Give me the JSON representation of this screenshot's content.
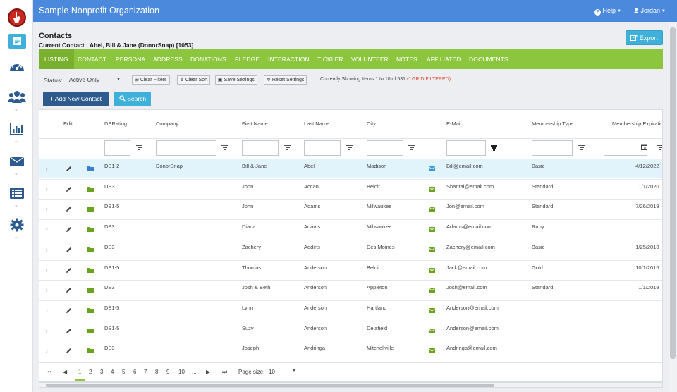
{
  "app": {
    "org_name": "Sample Nonprofit Organization",
    "help_label": "Help",
    "user_label": "Jordan"
  },
  "header": {
    "title": "Contacts",
    "current_contact": "Current Contact : Abel, Bill & Jane (DonorSnap) [1053]",
    "export_label": "Export"
  },
  "tabs": [
    "LISTING",
    "CONTACT",
    "PERSONA",
    "ADDRESS",
    "DONATIONS",
    "PLEDGE",
    "INTERACTION",
    "TICKLER",
    "VOLUNTEER",
    "NOTES",
    "AFFILIATED",
    "DOCUMENTS"
  ],
  "toolbar": {
    "status_label": "Status:",
    "status_value": "Active Only",
    "clear_filters": "Clear Filters",
    "clear_sort": "Clear Sort",
    "save_settings": "Save Settings",
    "reset_settings": "Reset Settings",
    "showing_text": "Currently Showing Items 1 to 10 of 531",
    "filtered_text": "(* GRID FILTERED)",
    "add_label": "Add New Contact",
    "search_label": "Search"
  },
  "columns": [
    "Edit",
    "DSRating",
    "Company",
    "First Name",
    "Last Name",
    "City",
    "E-Mail",
    "Membership Type",
    "Membership Expiration"
  ],
  "rows": [
    {
      "dsrating": "DS1-2",
      "company": "DonorSnap",
      "first": "Bill & Jane",
      "last": "Abel",
      "city": "Madison",
      "email": "Bill@email.com",
      "mtype": "Basic",
      "mexp": "4/12/2022"
    },
    {
      "dsrating": "DS3",
      "company": "",
      "first": "John",
      "last": "Accani",
      "city": "Beloit",
      "email": "Shantai@email.com",
      "mtype": "Standard",
      "mexp": "1/1/2020"
    },
    {
      "dsrating": "DS1-5",
      "company": "",
      "first": "John",
      "last": "Adams",
      "city": "Milwaukee",
      "email": "Jon@email.com",
      "mtype": "Standard",
      "mexp": "7/26/2019"
    },
    {
      "dsrating": "DS3",
      "company": "",
      "first": "Diana",
      "last": "Adams",
      "city": "Milwaukee",
      "email": "Adams@email.com",
      "mtype": "Ruby",
      "mexp": ""
    },
    {
      "dsrating": "DS3",
      "company": "",
      "first": "Zachery",
      "last": "Addins",
      "city": "Des Moines",
      "email": "Zachery@email.com",
      "mtype": "Basic",
      "mexp": "1/25/2018"
    },
    {
      "dsrating": "DS1-5",
      "company": "",
      "first": "Thomas",
      "last": "Anderson",
      "city": "Beloit",
      "email": "Jack@email.com",
      "mtype": "Gold",
      "mexp": "10/1/2016"
    },
    {
      "dsrating": "DS3",
      "company": "",
      "first": "Josh & Beth",
      "last": "Anderson",
      "city": "Appleton",
      "email": "Josh@email.com",
      "mtype": "Standard",
      "mexp": "1/1/2019"
    },
    {
      "dsrating": "DS1-5",
      "company": "",
      "first": "Lynn",
      "last": "Anderson",
      "city": "Hartland",
      "email": "Anderson@email.com",
      "mtype": "",
      "mexp": ""
    },
    {
      "dsrating": "DS1-5",
      "company": "",
      "first": "Suzy",
      "last": "Anderson",
      "city": "Delafield",
      "email": "Anderson@email.com",
      "mtype": "",
      "mexp": ""
    },
    {
      "dsrating": "DS3",
      "company": "",
      "first": "Joseph",
      "last": "Andringa",
      "city": "Mitchellville",
      "email": "Andringa@email.com",
      "mtype": "",
      "mexp": ""
    }
  ],
  "pager": {
    "pages": [
      "1",
      "2",
      "3",
      "4",
      "5",
      "6",
      "7",
      "8",
      "9",
      "10",
      "..."
    ],
    "page_size_label": "Page size:",
    "page_size_value": "10"
  },
  "colors": {
    "topbar": "#4a89dc",
    "tabs": "#8cc63f",
    "accent": "#3fb0d9",
    "primary_button": "#2d5b8e",
    "filtered": "#e04b33"
  }
}
